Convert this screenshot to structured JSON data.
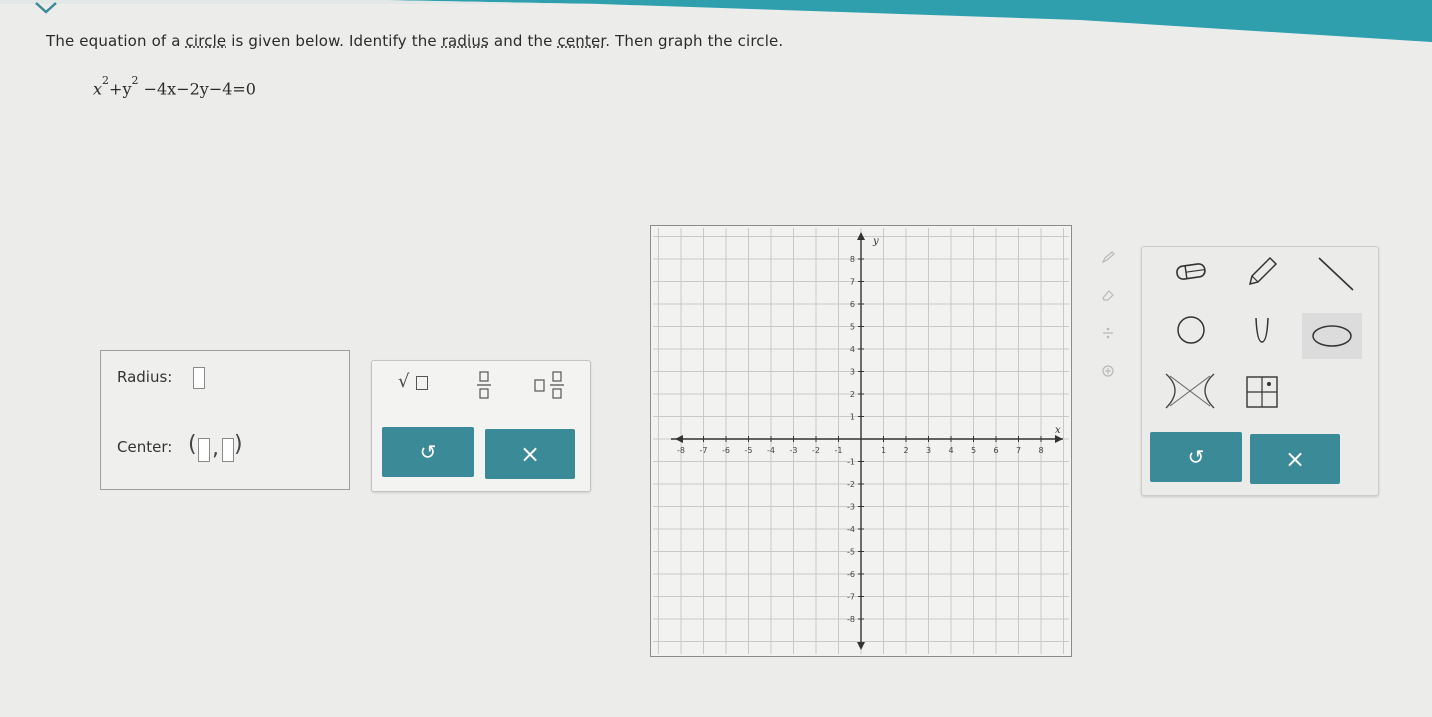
{
  "question": {
    "part1": "The equation of a ",
    "link_circle": "circle",
    "part2": " is given below. Identify the ",
    "link_radius": "radius",
    "part3": " and the ",
    "link_center": "center",
    "part4": ". Then graph the circle."
  },
  "equation": {
    "x": "x",
    "exp1": "2",
    "plus_y": "+y",
    "exp2": "2",
    "rest": "−4x−2y−4=0"
  },
  "answer": {
    "radius_label": "Radius:",
    "center_label": "Center:",
    "center_open": "(",
    "center_comma": ",",
    "center_close": ")"
  },
  "tools": {
    "sqrt": "√",
    "undo": "↺",
    "clear": "×"
  },
  "draw_tools": {
    "undo": "↺",
    "clear": "×"
  },
  "graph": {
    "x_axis_label": "x",
    "y_axis_label": "y",
    "x_ticks": [
      "-8",
      "-7",
      "-6",
      "-5",
      "-4",
      "-3",
      "-2",
      "-1",
      "1",
      "2",
      "3",
      "4",
      "5",
      "6",
      "7",
      "8"
    ],
    "y_ticks": [
      "8",
      "7",
      "6",
      "5",
      "4",
      "3",
      "2",
      "1",
      "-1",
      "-2",
      "-3",
      "-4",
      "-5",
      "-6",
      "-7",
      "-8"
    ]
  },
  "colors": {
    "accent": "#3a8a98",
    "topbar": "#2f9fae"
  }
}
